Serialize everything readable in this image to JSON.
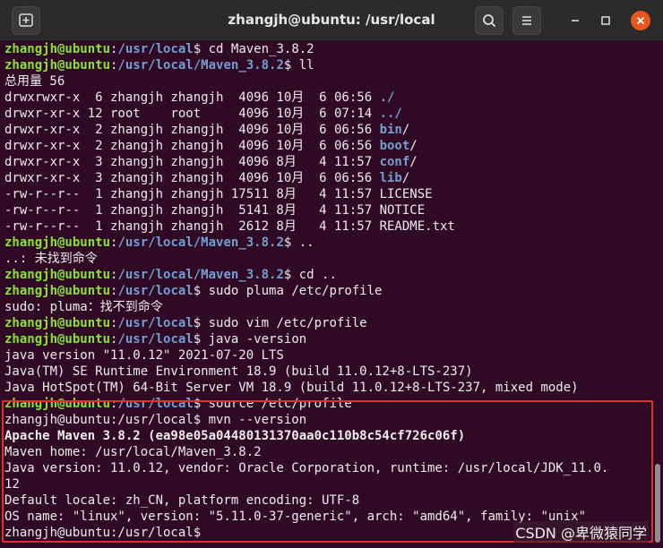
{
  "window": {
    "title": "zhangjh@ubuntu: /usr/local",
    "colors": {
      "background": "#300a24",
      "user_host": "#8ae234",
      "path": "#729fcf",
      "highlight_border": "#e02d2d"
    }
  },
  "titlebar": {
    "new_tab_icon": "new-tab-icon",
    "search_icon": "search-icon",
    "menu_icon": "hamburger-menu-icon",
    "minimize_icon": "minimize-icon",
    "maximize_icon": "maximize-icon",
    "close_icon": "close-icon"
  },
  "terminal": {
    "lines": [
      [
        {
          "t": "zhangjh@ubuntu",
          "c": "u"
        },
        {
          "t": ":",
          "c": ""
        },
        {
          "t": "/usr/local",
          "c": "p"
        },
        {
          "t": "$ cd Maven_3.8.2",
          "c": ""
        }
      ],
      [
        {
          "t": "zhangjh@ubuntu",
          "c": "u"
        },
        {
          "t": ":",
          "c": ""
        },
        {
          "t": "/usr/local/Maven_3.8.2",
          "c": "p"
        },
        {
          "t": "$ ll",
          "c": ""
        }
      ],
      [
        {
          "t": "总用量 56",
          "c": ""
        }
      ],
      [
        {
          "t": "drwxrwxr-x  6 zhangjh zhangjh  4096 10月  6 06:56 ",
          "c": ""
        },
        {
          "t": "./",
          "c": "d"
        }
      ],
      [
        {
          "t": "drwxr-xr-x 12 root    root     4096 10月  6 07:14 ",
          "c": ""
        },
        {
          "t": "../",
          "c": "d"
        }
      ],
      [
        {
          "t": "drwxr-xr-x  2 zhangjh zhangjh  4096 10月  6 06:56 ",
          "c": ""
        },
        {
          "t": "bin",
          "c": "d"
        },
        {
          "t": "/",
          "c": ""
        }
      ],
      [
        {
          "t": "drwxr-xr-x  2 zhangjh zhangjh  4096 10月  6 06:56 ",
          "c": ""
        },
        {
          "t": "boot",
          "c": "d"
        },
        {
          "t": "/",
          "c": ""
        }
      ],
      [
        {
          "t": "drwxr-xr-x  3 zhangjh zhangjh  4096 8月   4 11:57 ",
          "c": ""
        },
        {
          "t": "conf",
          "c": "d"
        },
        {
          "t": "/",
          "c": ""
        }
      ],
      [
        {
          "t": "drwxr-xr-x  3 zhangjh zhangjh  4096 10月  6 06:56 ",
          "c": ""
        },
        {
          "t": "lib",
          "c": "d"
        },
        {
          "t": "/",
          "c": ""
        }
      ],
      [
        {
          "t": "-rw-r--r--  1 zhangjh zhangjh 17511 8月   4 11:57 LICENSE",
          "c": ""
        }
      ],
      [
        {
          "t": "-rw-r--r--  1 zhangjh zhangjh  5141 8月   4 11:57 NOTICE",
          "c": ""
        }
      ],
      [
        {
          "t": "-rw-r--r--  1 zhangjh zhangjh  2612 8月   4 11:57 README.txt",
          "c": ""
        }
      ],
      [
        {
          "t": "zhangjh@ubuntu",
          "c": "u"
        },
        {
          "t": ":",
          "c": ""
        },
        {
          "t": "/usr/local/Maven_3.8.2",
          "c": "p"
        },
        {
          "t": "$ ..",
          "c": ""
        }
      ],
      [
        {
          "t": "..: 未找到命令",
          "c": ""
        }
      ],
      [
        {
          "t": "zhangjh@ubuntu",
          "c": "u"
        },
        {
          "t": ":",
          "c": ""
        },
        {
          "t": "/usr/local/Maven_3.8.2",
          "c": "p"
        },
        {
          "t": "$ cd ..",
          "c": ""
        }
      ],
      [
        {
          "t": "zhangjh@ubuntu",
          "c": "u"
        },
        {
          "t": ":",
          "c": ""
        },
        {
          "t": "/usr/local",
          "c": "p"
        },
        {
          "t": "$ sudo pluma /etc/profile",
          "c": ""
        }
      ],
      [
        {
          "t": "sudo: pluma：找不到命令",
          "c": ""
        }
      ],
      [
        {
          "t": "zhangjh@ubuntu",
          "c": "u"
        },
        {
          "t": ":",
          "c": ""
        },
        {
          "t": "/usr/local",
          "c": "p"
        },
        {
          "t": "$ sudo vim /etc/profile",
          "c": ""
        }
      ],
      [
        {
          "t": "zhangjh@ubuntu",
          "c": "u"
        },
        {
          "t": ":",
          "c": ""
        },
        {
          "t": "/usr/local",
          "c": "p"
        },
        {
          "t": "$ java -version",
          "c": ""
        }
      ],
      [
        {
          "t": "java version \"11.0.12\" 2021-07-20 LTS",
          "c": ""
        }
      ],
      [
        {
          "t": "Java(TM) SE Runtime Environment 18.9 (build 11.0.12+8-LTS-237)",
          "c": ""
        }
      ],
      [
        {
          "t": "Java HotSpot(TM) 64-Bit Server VM 18.9 (build 11.0.12+8-LTS-237, mixed mode)",
          "c": ""
        }
      ],
      [
        {
          "t": "zhangjh@ubuntu",
          "c": "u"
        },
        {
          "t": ":",
          "c": ""
        },
        {
          "t": "/usr/local",
          "c": "p"
        },
        {
          "t": "$ source /etc/profile",
          "c": ""
        }
      ],
      [
        {
          "t": "zhangjh@ubuntu:/usr/local$ mvn --version",
          "c": ""
        }
      ],
      [
        {
          "t": "Apache Maven 3.8.2 (ea98e05a04480131370aa0c110b8c54cf726c06f)",
          "c": "b"
        }
      ],
      [
        {
          "t": "Maven home: /usr/local/Maven_3.8.2",
          "c": ""
        }
      ],
      [
        {
          "t": "Java version: 11.0.12, vendor: Oracle Corporation, runtime: /usr/local/JDK_11.0.",
          "c": ""
        }
      ],
      [
        {
          "t": "12",
          "c": ""
        }
      ],
      [
        {
          "t": "Default locale: zh_CN, platform encoding: UTF-8",
          "c": ""
        }
      ],
      [
        {
          "t": "OS name: \"linux\", version: \"5.11.0-37-generic\", arch: \"amd64\", family: \"unix\"",
          "c": ""
        }
      ],
      [
        {
          "t": "zhangjh@ubuntu:/usr/local$",
          "c": ""
        }
      ]
    ]
  },
  "watermark": "CSDN @卑微猿同学"
}
